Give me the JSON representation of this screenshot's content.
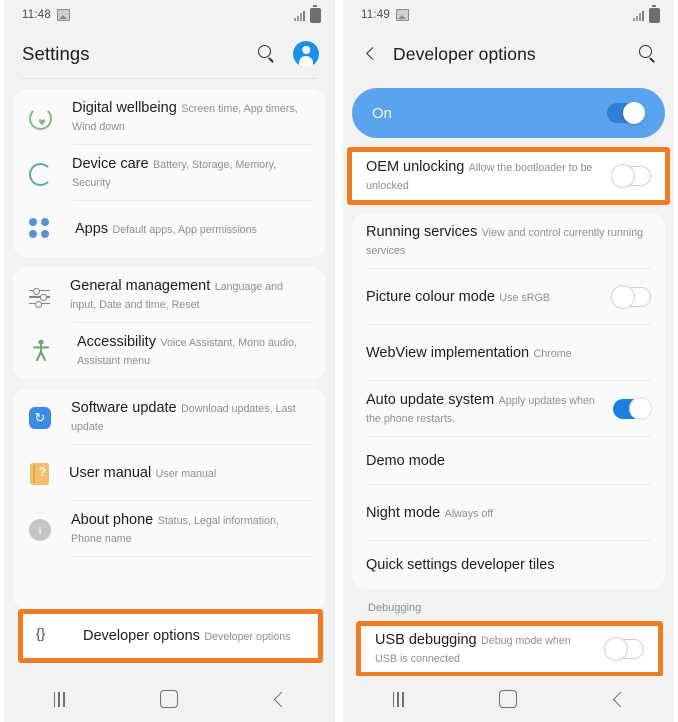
{
  "left": {
    "status": {
      "time": "11:48",
      "image_icon": "image-icon",
      "signal_icon": "signal-bars-icon",
      "battery_icon": "battery-icon"
    },
    "appbar": {
      "title": "Settings",
      "search_icon": "search-icon",
      "avatar_icon": "account-avatar-icon"
    },
    "groups": [
      {
        "items": [
          {
            "icon": "digital-wellbeing-icon",
            "title": "Digital wellbeing",
            "sub": "Screen time, App timers, Wind down"
          },
          {
            "icon": "device-care-icon",
            "title": "Device care",
            "sub": "Battery, Storage, Memory, Security"
          },
          {
            "icon": "apps-icon",
            "title": "Apps",
            "sub": "Default apps, App permissions"
          }
        ]
      },
      {
        "items": [
          {
            "icon": "general-management-icon",
            "title": "General management",
            "sub": "Language and input, Date and time, Reset"
          },
          {
            "icon": "accessibility-icon",
            "title": "Accessibility",
            "sub": "Voice Assistant, Mono audio, Assistant menu"
          }
        ]
      },
      {
        "items": [
          {
            "icon": "software-update-icon",
            "title": "Software update",
            "sub": "Download updates, Last update"
          },
          {
            "icon": "user-manual-icon",
            "title": "User manual",
            "sub": "User manual"
          },
          {
            "icon": "about-phone-icon",
            "title": "About phone",
            "sub": "Status, Legal information, Phone name"
          }
        ]
      }
    ],
    "highlighted_row": {
      "icon": "developer-options-icon",
      "title": "Developer options",
      "sub": "Developer options",
      "highlight_color": "#ef7b22"
    },
    "navbar": {
      "recents": "recents-icon",
      "home": "home-icon",
      "back": "back-icon"
    }
  },
  "right": {
    "status": {
      "time": "11:49",
      "image_icon": "image-icon",
      "signal_icon": "signal-bars-icon",
      "battery_icon": "battery-icon"
    },
    "appbar": {
      "back_icon": "back-chevron-icon",
      "title": "Developer options",
      "search_icon": "search-icon"
    },
    "banner": {
      "label": "On",
      "toggle_state": "on",
      "color": "#5ba3ef"
    },
    "highlighted_oem": {
      "title": "OEM unlocking",
      "sub": "Allow the bootloader to be unlocked",
      "toggle_state": "off",
      "highlight_color": "#ef7b22"
    },
    "items": [
      {
        "title": "Running services",
        "sub": "View and control currently running services",
        "toggle": "none"
      },
      {
        "title": "Picture colour mode",
        "sub": "Use sRGB",
        "toggle": "off"
      },
      {
        "title": "WebView implementation",
        "sub": "Chrome",
        "toggle": "none"
      },
      {
        "title": "Auto update system",
        "sub": "Apply updates when the phone restarts.",
        "toggle": "on"
      },
      {
        "title": "Demo mode",
        "sub": "",
        "toggle": "none"
      },
      {
        "title": "Night mode",
        "sub": "Always off",
        "toggle": "none"
      },
      {
        "title": "Quick settings developer tiles",
        "sub": "",
        "toggle": "none"
      }
    ],
    "section_label": "Debugging",
    "highlighted_usb": {
      "title": "USB debugging",
      "sub": "Debug mode when USB is connected",
      "toggle_state": "off",
      "highlight_color": "#ef7b22"
    },
    "navbar": {
      "recents": "recents-icon",
      "home": "home-icon",
      "back": "back-icon"
    }
  }
}
